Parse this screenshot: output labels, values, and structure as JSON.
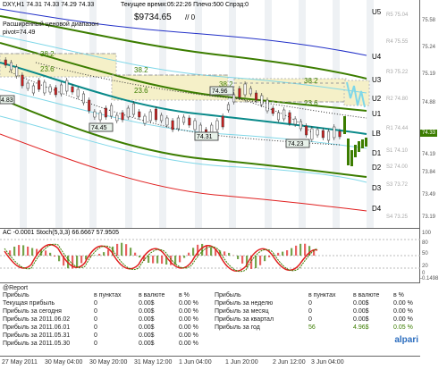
{
  "chart_header": {
    "symbol_line": "DXY,H1  74.31 74.33 74.29 74.33",
    "server_time_label": "Текущее время:05:22:26 Плечо:500 Спрэд:0",
    "balance": "$9734.65",
    "balance_suffix": "// 0",
    "pivot_title": "Расширенный ценовой диапазон",
    "pivot_value": "pivot=74.49"
  },
  "levels": {
    "U5": "U5",
    "U4": "U4",
    "U3": "U3",
    "U2": "U2",
    "U1": "U1",
    "LB": "LB",
    "D1": "D1",
    "D2": "D2",
    "D3": "D3",
    "D4": "D4"
  },
  "right_level_labels": {
    "R5": "R5 75.04",
    "R4": "R4 75.55",
    "R3": "R3 75.22",
    "R2": "R2 74.80",
    "R1": "R1 74.44",
    "S1": "S1 74.10",
    "S2": "S2 74.00",
    "S3": "S3 73.72",
    "S4": "S4 73.25"
  },
  "price_axis": [
    "75.58",
    "75.24",
    "75.19",
    "74.88",
    "74.33",
    "74.19",
    "73.84",
    "73.49",
    "73.19"
  ],
  "current_price_tag": "74.33",
  "price_labels": [
    "38.2",
    "23.6",
    "38.2",
    "23.6",
    "38.2",
    "38.2",
    "23.6",
    "74.45",
    "74.31",
    "74.96",
    "74.23",
    "4.83"
  ],
  "oscillator": {
    "header": "AC -0.0001  Stoch(5,3,3) 66.6667 57.9505",
    "axis": [
      "100",
      "80",
      "50",
      "20",
      "0",
      "-0.1498"
    ]
  },
  "report": {
    "title": "@Report",
    "left_headers": [
      "Прибыль",
      "в пунктах",
      "в валюте",
      "в %"
    ],
    "left_rows": [
      [
        "Текущая прибыль",
        "0",
        "0.00$",
        "0.00 %"
      ],
      [
        "Прибыль за сегодня",
        "0",
        "0.00$",
        "0.00 %"
      ],
      [
        "Прибыль за 2011.06.02",
        "0",
        "0.00$",
        "0.00 %"
      ],
      [
        "Прибыль за 2011.06.01",
        "0",
        "0.00$",
        "0.00 %"
      ],
      [
        "Прибыль за 2011.05.31",
        "0",
        "0.00$",
        "0.00 %"
      ],
      [
        "Прибыль за 2011.05.30",
        "0",
        "0.00$",
        "0.00 %"
      ]
    ],
    "right_headers": [
      "Прибыль",
      "в пунктах",
      "в валюте",
      "в %"
    ],
    "right_rows": [
      [
        "Прибыль за неделю",
        "0",
        "0.00$",
        "0.00 %"
      ],
      [
        "Прибыль за месяц",
        "0",
        "0.00$",
        "0.00 %"
      ],
      [
        "Прибыль за квартал",
        "0",
        "0.00$",
        "0.00 %"
      ],
      [
        "Прибыль за год",
        "56",
        "4.96$",
        "0.05 %"
      ]
    ]
  },
  "time_axis": [
    "27 May 2011",
    "30 May 04:00",
    "30 May 20:00",
    "31 May 12:00",
    "1 Jun 04:00",
    "1 Jun 20:00",
    "2 Jun 12:00",
    "3 Jun 04:00"
  ],
  "brand": "alpari",
  "colors": {
    "teal": "#0a8a8a",
    "green": "#3c7d00",
    "blue": "#2230c8",
    "red": "#e02020",
    "cyan": "#7fd7e8",
    "pivot_box": "#f5f0c8"
  }
}
